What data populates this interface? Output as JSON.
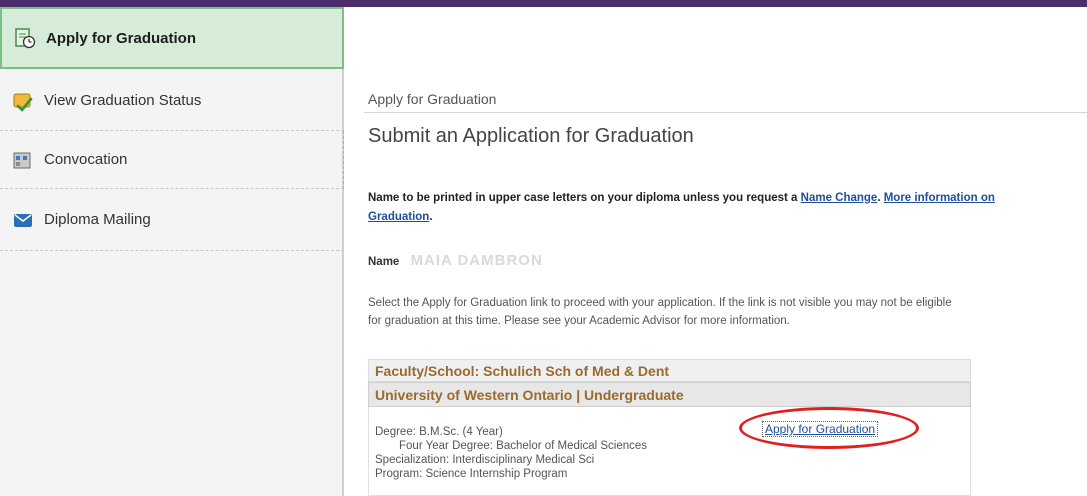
{
  "sidebar": {
    "items": [
      {
        "label": "Apply for Graduation",
        "icon": "clipboard-clock-icon",
        "active": true
      },
      {
        "label": "View Graduation Status",
        "icon": "status-check-icon",
        "active": false
      },
      {
        "label": "Convocation",
        "icon": "building-icon",
        "active": false
      },
      {
        "label": "Diploma Mailing",
        "icon": "envelope-icon",
        "active": false
      }
    ]
  },
  "main": {
    "breadcrumb": "Apply for Graduation",
    "title": "Submit an Application for Graduation",
    "notice": {
      "prefix": "Name to be printed in upper case letters on your diploma unless you request a ",
      "name_change_link": "Name Change",
      "middle": ". ",
      "more_info_link": "More information on Graduation",
      "suffix": "."
    },
    "name_label": "Name",
    "name_value": "MAIA DAMBRON",
    "instructions": "Select the Apply for Graduation link to proceed with your application. If the link is not visible you may not be eligible for graduation at this time. Please see your Academic Advisor for more information.",
    "faculty": "Faculty/School: Schulich Sch of Med & Dent",
    "university": "University of Western Ontario | Undergraduate",
    "degree": "Degree: B.M.Sc. (4 Year)",
    "degree_desc": "Four Year Degree: Bachelor of Medical Sciences",
    "specialization": "Specialization: Interdisciplinary Medical Sci",
    "program": "Program: Science Internship Program",
    "apply_link": "Apply for Graduation"
  },
  "colors": {
    "accent_purple": "#4b2e6b",
    "active_green": "#d6ecd9",
    "link_blue": "#1f4e9c",
    "faculty_brown": "#9a6a2e",
    "highlight_red": "#e02020"
  }
}
